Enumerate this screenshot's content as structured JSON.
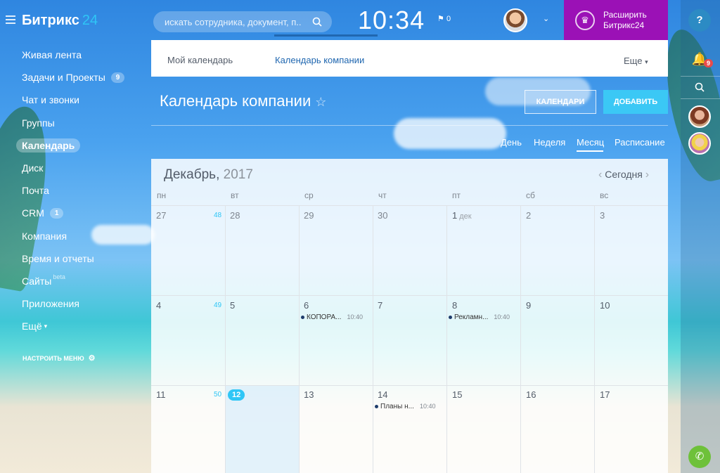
{
  "header": {
    "logo": "Битрикс",
    "logo_num": "24",
    "search_placeholder": "искать сотрудника, документ, п...",
    "time": "10:34",
    "flag_count": "0",
    "upgrade_line1": "Расширить",
    "upgrade_line2": "Битрикс24"
  },
  "sidebar": {
    "items": [
      {
        "label": "Живая лента"
      },
      {
        "label": "Задачи и Проекты",
        "badge": "9"
      },
      {
        "label": "Чат и звонки"
      },
      {
        "label": "Группы"
      },
      {
        "label": "Календарь"
      },
      {
        "label": "Диск"
      },
      {
        "label": "Почта"
      },
      {
        "label": "CRM",
        "badge": "1"
      },
      {
        "label": "Компания"
      },
      {
        "label": "Время и отчеты"
      },
      {
        "label": "Сайты",
        "sup": "beta"
      },
      {
        "label": "Приложения"
      },
      {
        "label": "Ещё"
      }
    ],
    "setup_label": "НАСТРОИТЬ МЕНЮ"
  },
  "tabs": {
    "my_calendar": "Мой календарь",
    "company_calendar": "Календарь компании",
    "more": "Еще"
  },
  "page": {
    "title": "Календарь компании",
    "calendars_button": "КАЛЕНДАРИ",
    "add_button": "ДОБАВИТЬ"
  },
  "views": {
    "day": "День",
    "week": "Неделя",
    "month": "Месяц",
    "schedule": "Расписание"
  },
  "calendar": {
    "month": "Декабрь,",
    "year": "2017",
    "today": "Сегодня",
    "weekdays": [
      "пн",
      "вт",
      "ср",
      "чт",
      "пт",
      "сб",
      "вс"
    ],
    "weeks": [
      {
        "num": "48",
        "days": [
          "27",
          "28",
          "29",
          "30",
          "1",
          "2",
          "3"
        ],
        "month_label": "дек"
      },
      {
        "num": "49",
        "days": [
          "4",
          "5",
          "6",
          "7",
          "8",
          "9",
          "10"
        ]
      },
      {
        "num": "50",
        "days": [
          "11",
          "12",
          "13",
          "14",
          "15",
          "16",
          "17"
        ]
      }
    ],
    "events": [
      {
        "title": "КОПОРА...",
        "time": "10:40"
      },
      {
        "title": "Рекламн...",
        "time": "10:40"
      },
      {
        "title": "Планы н...",
        "time": "10:40"
      }
    ]
  },
  "rail": {
    "help": "?",
    "notifications_count": "9"
  },
  "colors": {
    "upgrade_bg": "#9b11b6",
    "accent": "#2fc6f6",
    "add_button": "#3bc8f5",
    "tab_active": "#2067b0"
  }
}
